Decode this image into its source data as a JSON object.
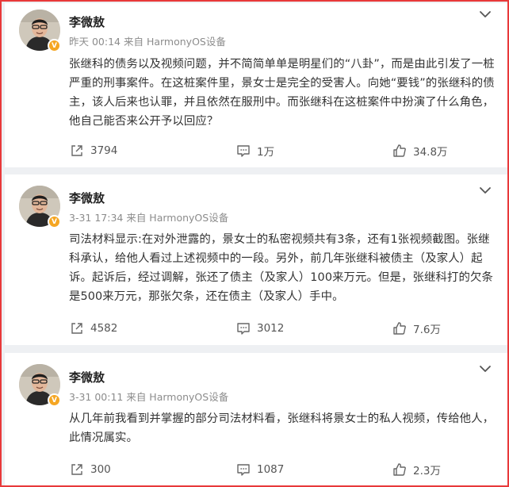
{
  "posts": [
    {
      "author": "李微敖",
      "meta": "昨天 00:14  来自 HarmonyOS设备",
      "text": "张继科的债务以及视频问题，并不简简单单是明星们的“八卦”，而是由此引发了一桩严重的刑事案件。在这桩案件里，景女士是完全的受害人。向她“要钱”的张继科的债主，该人后来也认罪，并且依然在服刑中。而张继科在这桩案件中扮演了什么角色，他自己能否来公开予以回应？",
      "shares": "3794",
      "comments": "1万",
      "likes": "34.8万"
    },
    {
      "author": "李微敖",
      "meta": "3-31 17:34  来自 HarmonyOS设备",
      "text": "司法材料显示:在对外泄露的，景女士的私密视频共有3条，还有1张视频截图。张继科承认，给他人看过上述视频中的一段。另外，前几年张继科被债主（及家人）起诉。起诉后，经过调解，张还了债主（及家人）100来万元。但是，张继科打的欠条是500来万元，那张欠条，还在债主（及家人）手中。",
      "shares": "4582",
      "comments": "3012",
      "likes": "7.6万"
    },
    {
      "author": "李微敖",
      "meta": "3-31 00:11  来自 HarmonyOS设备",
      "text": "从几年前我看到并掌握的部分司法材料看，张继科将景女士的私人视频，传给他人，此情况属实。",
      "shares": "300",
      "comments": "1087",
      "likes": "2.3万"
    }
  ],
  "badge": "V",
  "icons": {
    "share": "share-icon",
    "comment": "comment-icon",
    "like": "thumbs-up-icon",
    "menu": "chevron-down-icon",
    "verified": "verified-badge-icon"
  },
  "colors": {
    "frame": "#e8393a",
    "background": "#eef0f3",
    "badge": "#f5a623",
    "text": "#333333",
    "meta": "#8c8c8c"
  }
}
